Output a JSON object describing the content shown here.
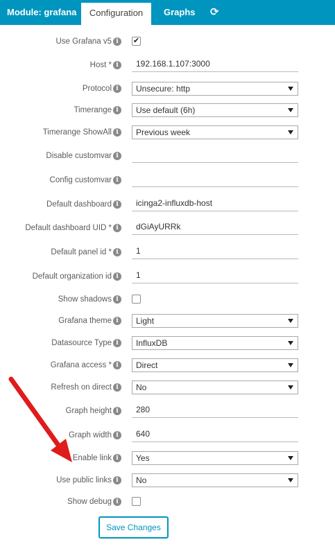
{
  "tabs": {
    "module": "Module: grafana",
    "configuration": "Configuration",
    "graphs": "Graphs",
    "refresh_icon": "⟳"
  },
  "info_icon_glyph": "i",
  "form": {
    "use_grafana_v5": {
      "label": "Use Grafana v5",
      "checked": true,
      "mark": "✔"
    },
    "host": {
      "label": "Host *",
      "value": "192.168.1.107:3000"
    },
    "protocol": {
      "label": "Protocol",
      "value": "Unsecure: http"
    },
    "timerange": {
      "label": "Timerange",
      "value": "Use default (6h)"
    },
    "timerange_showall": {
      "label": "Timerange ShowAll",
      "value": "Previous week"
    },
    "disable_customvar": {
      "label": "Disable customvar",
      "value": ""
    },
    "config_customvar": {
      "label": "Config customvar",
      "value": ""
    },
    "default_dashboard": {
      "label": "Default dashboard",
      "value": "icinga2-influxdb-host"
    },
    "default_dashboard_uid": {
      "label": "Default dashboard UID *",
      "value": "dGiAyURRk"
    },
    "default_panel_id": {
      "label": "Default panel id *",
      "value": "1"
    },
    "default_org_id": {
      "label": "Default organization id",
      "value": "1"
    },
    "show_shadows": {
      "label": "Show shadows",
      "checked": false,
      "mark": ""
    },
    "grafana_theme": {
      "label": "Grafana theme",
      "value": "Light"
    },
    "datasource_type": {
      "label": "Datasource Type",
      "value": "InfluxDB"
    },
    "grafana_access": {
      "label": "Grafana access *",
      "value": "Direct"
    },
    "refresh_on_direct": {
      "label": "Refresh on direct",
      "value": "No"
    },
    "graph_height": {
      "label": "Graph height",
      "value": "280"
    },
    "graph_width": {
      "label": "Graph width",
      "value": "640"
    },
    "enable_link": {
      "label": "Enable link",
      "value": "Yes"
    },
    "use_public_links": {
      "label": "Use public links",
      "value": "No"
    },
    "show_debug": {
      "label": "Show debug",
      "checked": false,
      "mark": ""
    },
    "save_label": "Save Changes"
  },
  "colors": {
    "accent": "#0095bf",
    "annotation_arrow": "#e01b1b"
  }
}
